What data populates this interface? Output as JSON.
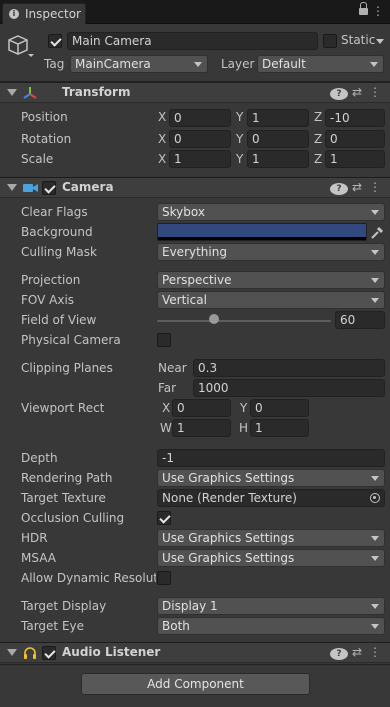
{
  "window": {
    "tab_label": "Inspector",
    "tab_icon_glyph": "i"
  },
  "gameobject": {
    "active": true,
    "name": "Main Camera",
    "static_label": "Static",
    "static_checked": false,
    "tag_label": "Tag",
    "tag_value": "MainCamera",
    "layer_label": "Layer",
    "layer_value": "Default"
  },
  "transform": {
    "title": "Transform",
    "position_label": "Position",
    "rotation_label": "Rotation",
    "scale_label": "Scale",
    "axis_x": "X",
    "axis_y": "Y",
    "axis_z": "Z",
    "position": {
      "x": "0",
      "y": "1",
      "z": "-10"
    },
    "rotation": {
      "x": "0",
      "y": "0",
      "z": "0"
    },
    "scale": {
      "x": "1",
      "y": "1",
      "z": "1"
    }
  },
  "camera": {
    "title": "Camera",
    "enabled": true,
    "clear_flags_label": "Clear Flags",
    "clear_flags": "Skybox",
    "background_label": "Background",
    "background_color": "#31497f",
    "culling_mask_label": "Culling Mask",
    "culling_mask": "Everything",
    "projection_label": "Projection",
    "projection": "Perspective",
    "fov_axis_label": "FOV Axis",
    "fov_axis": "Vertical",
    "fov_label": "Field of View",
    "fov_value": "60",
    "fov_slider_fraction": 0.33,
    "physical_camera_label": "Physical Camera",
    "physical_camera": false,
    "clipping_label": "Clipping Planes",
    "near_label": "Near",
    "near": "0.3",
    "far_label": "Far",
    "far": "1000",
    "viewport_label": "Viewport Rect",
    "vx_label": "X",
    "vy_label": "Y",
    "vw_label": "W",
    "vh_label": "H",
    "viewport": {
      "x": "0",
      "y": "0",
      "w": "1",
      "h": "1"
    },
    "depth_label": "Depth",
    "depth": "-1",
    "rendering_path_label": "Rendering Path",
    "rendering_path": "Use Graphics Settings",
    "target_texture_label": "Target Texture",
    "target_texture": "None (Render Texture)",
    "occlusion_label": "Occlusion Culling",
    "occlusion": true,
    "hdr_label": "HDR",
    "hdr": "Use Graphics Settings",
    "msaa_label": "MSAA",
    "msaa": "Use Graphics Settings",
    "dynamic_res_label": "Allow Dynamic Resoluti",
    "dynamic_res": false,
    "target_display_label": "Target Display",
    "target_display": "Display 1",
    "target_eye_label": "Target Eye",
    "target_eye": "Both"
  },
  "audio_listener": {
    "title": "Audio Listener",
    "enabled": true
  },
  "add_component_label": "Add Component",
  "icons": {
    "help": "?",
    "presets": "⇄",
    "menu": "⋮"
  }
}
